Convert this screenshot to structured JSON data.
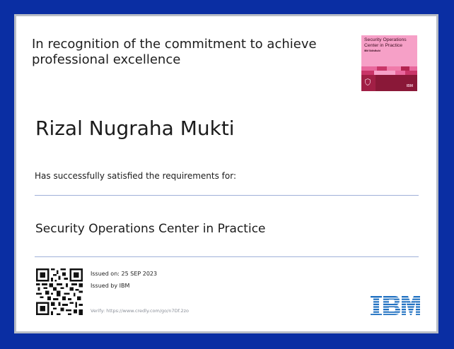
{
  "certificate": {
    "recognition_text": "In recognition of the commitment to achieve professional excellence",
    "recipient_name": "Rizal Nugraha Mukti",
    "satisfied_text": "Has successfully satisfied the requirements for:",
    "course_title": "Security Operations Center in Practice",
    "issued_on": "Issued on: 25 SEP 2023",
    "issued_by": "Issued by IBM",
    "verify_text": "Verify: https://www.credly.com/go/n7Df.2zo"
  },
  "badge": {
    "title": "Security Operations Center in Practice",
    "subtitle": "IBM SkillsBuild",
    "brand": "IBM"
  },
  "colors": {
    "background": "#0a2ea3",
    "paper": "#ffffff",
    "badge_pink": "#f6a0c7",
    "badge_maroon": "#8a1838",
    "ibm_blue": "#1f70c1",
    "rule": "#9fb0d8"
  },
  "icons": {
    "qr": "qr-code-icon",
    "shield": "shield-icon",
    "logo": "ibm-logo"
  }
}
